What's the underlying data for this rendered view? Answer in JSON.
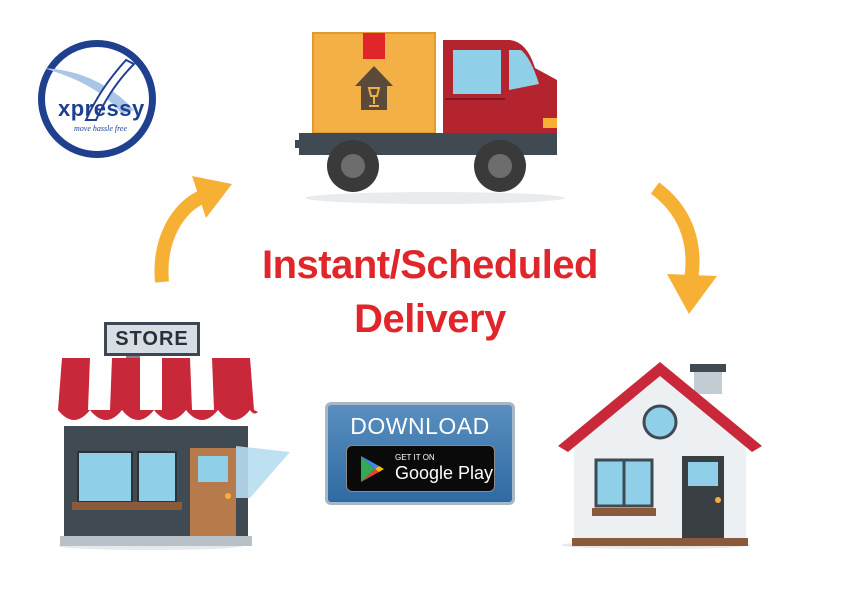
{
  "logo": {
    "brand": "xpressy",
    "tagline": "move hassle free",
    "colors": {
      "ring": "#1f3f8f",
      "swoosh": "#a9c6e8"
    }
  },
  "headline": {
    "line1": "Instant/Scheduled",
    "line2": "Delivery",
    "color": "#e0262b"
  },
  "download_badge": {
    "label": "DOWNLOAD",
    "store_small": "GET IT ON",
    "store_big": "Google Play"
  },
  "store": {
    "sign": "STORE"
  },
  "icons": [
    "truck-icon",
    "package-box-icon",
    "store-building-icon",
    "house-icon",
    "arrow-up-right-icon",
    "arrow-down-right-icon",
    "google-play-icon"
  ],
  "colors": {
    "arrow": "#f6b135",
    "red": "#c8283a",
    "window": "#8fcfe8",
    "dark": "#3f4a53"
  }
}
